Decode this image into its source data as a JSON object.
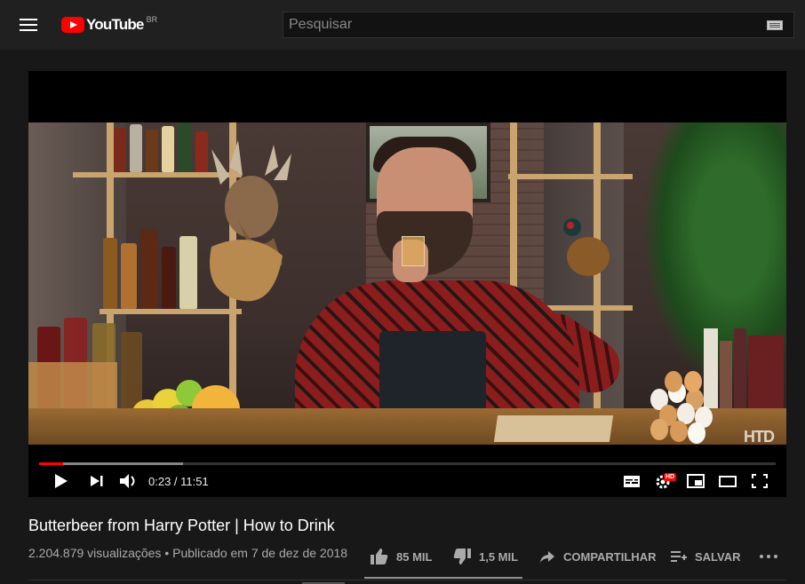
{
  "header": {
    "logo_text": "YouTube",
    "region": "BR",
    "search_placeholder": "Pesquisar"
  },
  "player": {
    "current_time": "0:23",
    "duration": "11:51",
    "time_display": "0:23 / 11:51",
    "progress_played_fraction": 0.033,
    "progress_loaded_fraction": 0.195,
    "watermark": "HTD",
    "quality_badge": "HD"
  },
  "video": {
    "title": "Butterbeer from Harry Potter | How to Drink",
    "views": "2.204.879 visualizações",
    "separator": "•",
    "published": "Publicado em 7 de dez de 2018"
  },
  "actions": {
    "likes": "85 MIL",
    "dislikes": "1,5 MIL",
    "share": "COMPARTILHAR",
    "save": "SALVAR"
  },
  "colors": {
    "brand_red": "#ff0000",
    "background": "#181818",
    "masthead": "#202020",
    "meta_text": "#aaaaaa"
  },
  "icons": [
    "menu-icon",
    "youtube-logo-icon",
    "keyboard-icon",
    "play-icon",
    "next-icon",
    "volume-icon",
    "subtitles-icon",
    "settings-icon",
    "miniplayer-icon",
    "theater-icon",
    "fullscreen-icon",
    "like-icon",
    "dislike-icon",
    "share-icon",
    "save-icon",
    "more-icon"
  ]
}
